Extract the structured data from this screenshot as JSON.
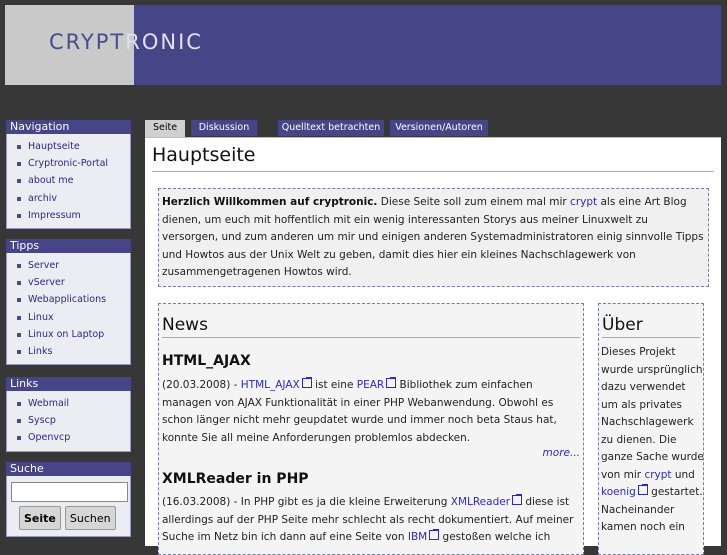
{
  "header": {
    "logo_a": "CRYPT",
    "logo_b": "RONIC"
  },
  "navigation": {
    "title": "Navigation",
    "items": [
      "Hauptseite",
      "Cryptronic-Portal",
      "about me",
      "archiv",
      "Impressum"
    ]
  },
  "tipps": {
    "title": "Tipps",
    "items": [
      "Server",
      "vServer",
      "Webapplications",
      "Linux",
      "Linux on Laptop",
      "Links"
    ]
  },
  "links": {
    "title": "Links",
    "items": [
      "Webmail",
      "Syscp",
      "Openvcp"
    ]
  },
  "search": {
    "title": "Suche",
    "value": "",
    "go_label": "Seite",
    "search_label": "Suchen"
  },
  "tabs": [
    "Seite",
    "Diskussion",
    "Quelltext betrachten",
    "Versionen/Autoren"
  ],
  "page": {
    "title": "Hauptseite",
    "welcome": {
      "bold": "Herzlich Willkommen auf cryptronic.",
      "t1": " Diese Seite soll zum einem mal mir ",
      "link1": "crypt",
      "t2": " als eine Art Blog dienen, um euch mit hoffentlich mit ein wenig interessanten Storys aus meiner Linuxwelt zu versorgen, und zum anderen um mir und einigen anderen Systemadministratoren einig sinnvolle Tipps und Howtos aus der Unix Welt zu geben, damit dies hier ein kleines Nachschlagewerk von zusammengetragenen Howtos wird."
    },
    "news": {
      "heading": "News",
      "articles": [
        {
          "title": "HTML_AJAX",
          "date": "(20.03.2008) - ",
          "link1": "HTML_AJAX",
          "t1": " ist eine ",
          "link2": "PEAR",
          "t2": " Bibliothek zum einfachen managen von AJAX Funktionalität in einer PHP Webanwendung. Obwohl es schon länger nicht mehr geupdatet wurde und immer noch beta Staus hat, konnte Sie all meine Anforderungen problemlos abdecken.",
          "more": "more..."
        },
        {
          "title": "XMLReader in PHP",
          "date": "(16.03.2008) - In PHP gibt es ja die kleine Erweiterung ",
          "link1": "XMLReader",
          "t1": " diese ist allerdings auf der PHP Seite mehr schlecht als recht dokumentiert. Auf meiner Suche im Netz bin ich dann auf eine Seite von ",
          "link2": "IBM",
          "t2": " gestoßen welche ich"
        }
      ]
    },
    "about": {
      "heading": "Über",
      "t1": "Dieses Projekt wurde ursprünglich dazu verwendet um als privates Nachschlagewerk zu dienen. Die ganze Sache wurde von mir ",
      "link1": "crypt",
      "t2": " und ",
      "link2": "koenig",
      "t3": " gestartet. Nacheinander kamen noch ein"
    }
  },
  "colors": {
    "accent": "#454588",
    "background": "#373737",
    "link": "#2a2acc"
  }
}
